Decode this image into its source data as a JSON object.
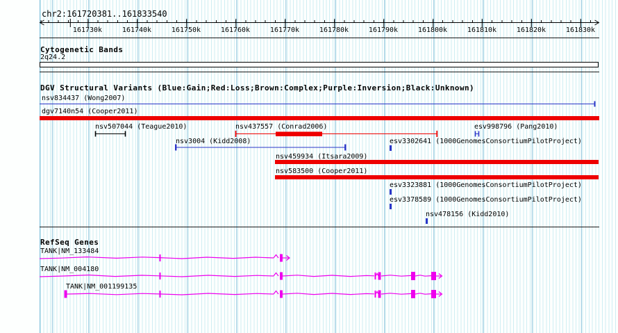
{
  "window": {
    "region": "chr2:161720381..161833540"
  },
  "ruler": {
    "tick_labels": [
      "161730k",
      "161740k",
      "161750k",
      "161760k",
      "161770k",
      "161780k",
      "161790k",
      "161800k",
      "161810k",
      "161820k",
      "161830k"
    ]
  },
  "cytogenetic": {
    "header": "Cytogenetic Bands",
    "band": "2q24.2"
  },
  "dgv": {
    "header": "DGV Structural Variants (Blue:Gain;Red:Loss;Brown:Complex;Purple:Inversion;Black:Unknown)",
    "legend": {
      "gain": "Blue",
      "loss": "Red",
      "complex": "Brown",
      "inversion": "Purple",
      "unknown": "Black"
    },
    "variants": [
      {
        "id": "nsv834437",
        "study": "Wong2007",
        "label": "nsv834437 (Wong2007)",
        "type": "gain"
      },
      {
        "id": "dgv7140n54",
        "study": "Cooper2011",
        "label": "dgv7140n54 (Cooper2011)",
        "type": "loss"
      },
      {
        "id": "nsv507044",
        "study": "Teague2010",
        "label": "nsv507044 (Teague2010)",
        "type": "unknown"
      },
      {
        "id": "nsv437557",
        "study": "Conrad2006",
        "label": "nsv437557 (Conrad2006)",
        "type": "loss"
      },
      {
        "id": "esv998796",
        "study": "Pang2010",
        "label": "esv998796 (Pang2010)",
        "type": "gain"
      },
      {
        "id": "nsv3004",
        "study": "Kidd2008",
        "label": "nsv3004 (Kidd2008)",
        "type": "gain"
      },
      {
        "id": "esv3302641",
        "study": "1000GenomesConsortiumPilotProject",
        "label": "esv3302641 (1000GenomesConsortiumPilotProject)",
        "type": "gain"
      },
      {
        "id": "nsv459934",
        "study": "Itsara2009",
        "label": "nsv459934 (Itsara2009)",
        "type": "loss"
      },
      {
        "id": "nsv583500",
        "study": "Cooper2011",
        "label": "nsv583500 (Cooper2011)",
        "type": "loss"
      },
      {
        "id": "esv3323881",
        "study": "1000GenomesConsortiumPilotProject",
        "label": "esv3323881 (1000GenomesConsortiumPilotProject)",
        "type": "gain"
      },
      {
        "id": "esv3378589",
        "study": "1000GenomesConsortiumPilotProject",
        "label": "esv3378589 (1000GenomesConsortiumPilotProject)",
        "type": "gain"
      },
      {
        "id": "nsv478156",
        "study": "Kidd2010",
        "label": "nsv478156 (Kidd2010)",
        "type": "gain"
      }
    ]
  },
  "refseq": {
    "header": "RefSeq Genes",
    "genes": [
      {
        "label": "TANK|NM_133484"
      },
      {
        "label": "TANK|NM_004180"
      },
      {
        "label": "TANK|NM_001199135"
      }
    ]
  },
  "colors": {
    "gain_blue": "#2b35c8",
    "loss_red": "#ee0000",
    "unknown_black": "#000000",
    "gene_magenta": "#ee00ee"
  }
}
